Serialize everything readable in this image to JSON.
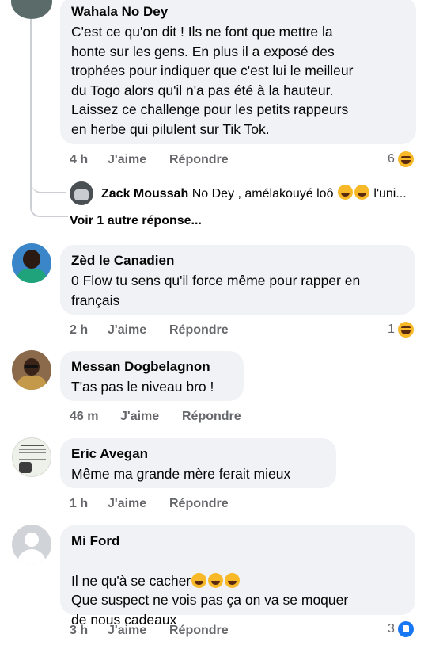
{
  "comments": [
    {
      "author": "Wahala No Dey",
      "text": "C'est ce qu'on dit ! Ils ne font que mettre la\nhonte sur les gens. En plus il a exposé des\ntrophées pour indiquer que c'est lui le meilleur\ndu Togo alors qu'il n'a pas été à la hauteur.\nLaissez ce challenge pour les petits rappeurs\nen herbe qui pilulent sur Tik Tok.",
      "time": "4 h",
      "like": "J'aime",
      "reply": "Répondre",
      "reactions": "6"
    },
    {
      "author": "Zèd le Canadien",
      "text": "0 Flow tu sens qu'il force même pour rapper en\nfrançais",
      "time": "2 h",
      "like": "J'aime",
      "reply": "Répondre",
      "reactions": "1"
    },
    {
      "author": "Messan Dogbelagnon",
      "text": "T'as pas le niveau bro !",
      "time": "46 m",
      "like": "J'aime",
      "reply": "Répondre"
    },
    {
      "author": "Eric Avegan",
      "text": "Même ma grande mère ferait mieux",
      "time": "1 h",
      "like": "J'aime",
      "reply": "Répondre"
    },
    {
      "author": "Mi Ford",
      "text_line1": "Il ne qu'à se cacher",
      "text_line2": "Que suspect ne vois pas ça  on va se moquer\nde nous cadeaux",
      "time": "3 h",
      "like": "J'aime",
      "reply": "Répondre",
      "reactions": "3"
    }
  ],
  "reply_preview": {
    "author": "Zack Moussah",
    "text": "No Dey , amélakouyé loô",
    "suffix": "l'uni..."
  },
  "more_replies": "Voir 1 autre réponse...",
  "colors": {
    "bubble": "#f0f2f5",
    "meta": "#65676b",
    "reaction": "#f7b928",
    "like": "#1877f2"
  },
  "icons": [
    "haha-reaction-icon",
    "like-reaction-icon",
    "default-avatar-icon"
  ]
}
